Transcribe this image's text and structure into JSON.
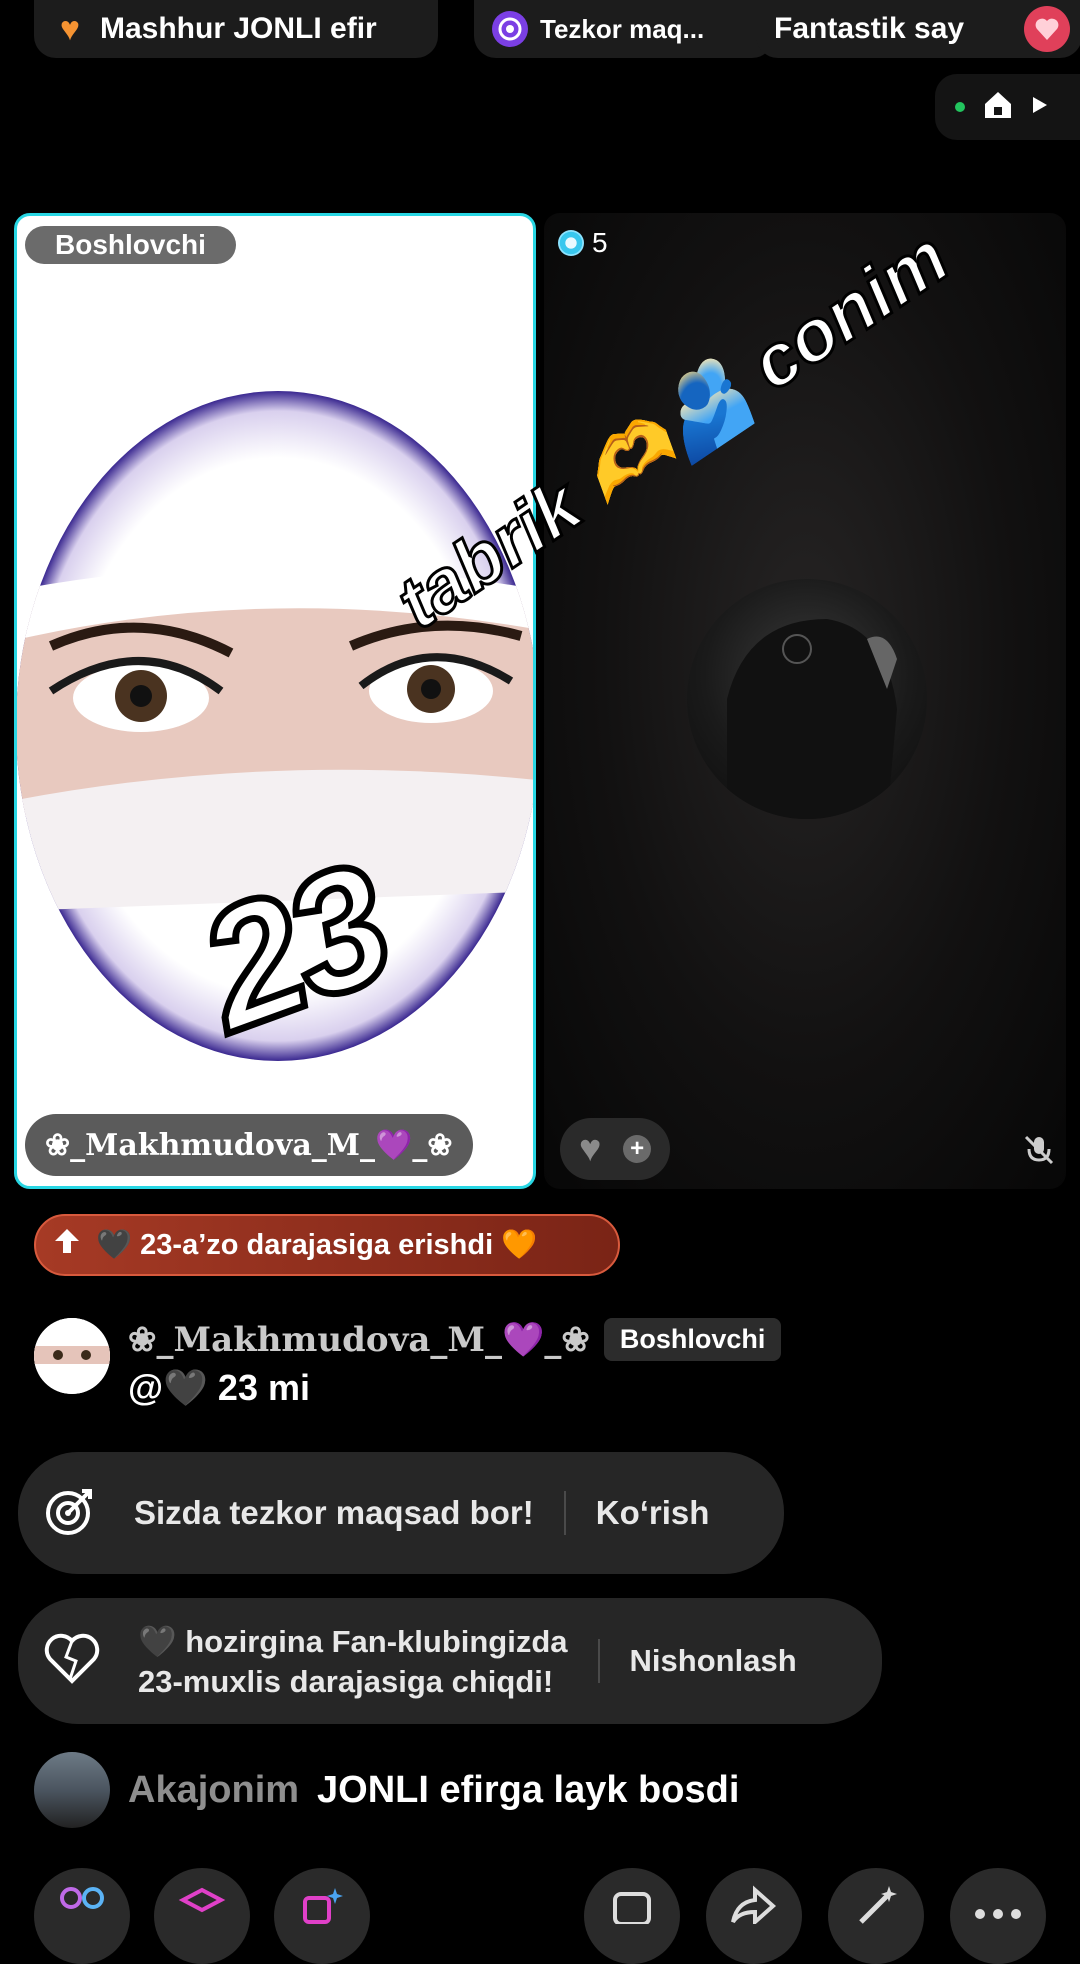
{
  "top_pills": [
    {
      "label": "Mashhur JONLI efir",
      "icon": "orange-heart-icon"
    },
    {
      "label": "Tezkor maq...",
      "icon": "target-icon"
    },
    {
      "label": "Fantastik say",
      "icon": "gift-icon"
    }
  ],
  "host_tile": {
    "role_badge": "Boshlovchi",
    "name": "❀_Makhmudova_M_💜_❀"
  },
  "guest_tile": {
    "gem_count": "5"
  },
  "overlay": {
    "number": "23",
    "word": "tabrik 🫶🫂 conim"
  },
  "level_banner": {
    "text": "🖤 23-a’zo darajasiga erishdi 🧡"
  },
  "chat": {
    "name": "❀_Makhmudova_M_💜_❀",
    "role": "Boshlovchi",
    "message": "@🖤 23 mi"
  },
  "goal_notice": {
    "text": "Sizda tezkor maqsad bor!",
    "action": "Ko‘rish"
  },
  "fan_notice": {
    "line1": "🖤 hozirgina Fan-klubingizda",
    "line2": "23-muxlis darajasiga chiqdi!",
    "action": "Nishonlash"
  },
  "like_event": {
    "user": "Akajonim",
    "text": "JONLI efirga layk bosdi"
  },
  "colors": {
    "host_border": "#28d6e3",
    "level_banner": "#a63a25",
    "accent_pink": "#e040c8"
  }
}
